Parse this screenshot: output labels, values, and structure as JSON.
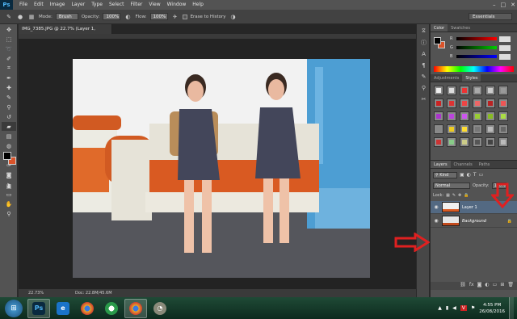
{
  "app": {
    "logo": "Ps",
    "menu": [
      "File",
      "Edit",
      "Image",
      "Layer",
      "Type",
      "Select",
      "Filter",
      "View",
      "Window",
      "Help"
    ],
    "window_controls": [
      "–",
      "□",
      "✕"
    ]
  },
  "options_bar": {
    "mode_label": "Mode:",
    "mode_value": "Brush",
    "opacity_label": "Opacity:",
    "opacity_value": "100%",
    "flow_label": "Flow:",
    "flow_value": "100%",
    "erase_history_label": "Erase to History",
    "workspace": "Essentials"
  },
  "document": {
    "tab_title": "IMG_7385.JPG @ 22.7% (Layer 1, RGB/8) *",
    "zoom": "22.73%",
    "doc_size": "Doc: 22.8M/45.6M"
  },
  "colors": {
    "foreground": "#000000",
    "background": "#d9532a",
    "accent": "#536982"
  },
  "color_panel": {
    "tabs": [
      "Color",
      "Swatches"
    ],
    "sliders": [
      "R",
      "G",
      "B"
    ]
  },
  "styles_panel": {
    "tabs": [
      "Adjustments",
      "Styles"
    ]
  },
  "layers_panel": {
    "tabs": [
      "Layers",
      "Channels",
      "Paths"
    ],
    "kind_filter": "Kind",
    "blend_mode": "Normal",
    "opacity_label": "Opacity:",
    "opacity_value": "100%",
    "lock_label": "Lock:",
    "layers": [
      {
        "name": "Layer 1",
        "selected": true
      },
      {
        "name": "Background",
        "selected": false
      }
    ]
  },
  "taskbar": {
    "time": "4:55 PM",
    "date": "26/08/2016"
  }
}
